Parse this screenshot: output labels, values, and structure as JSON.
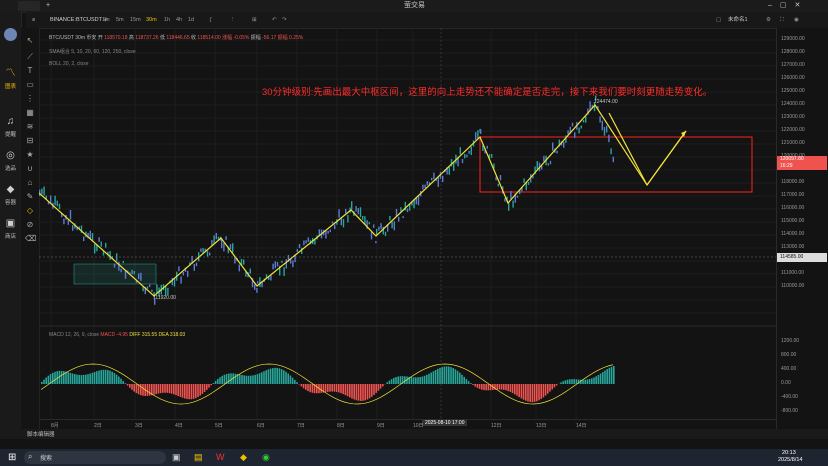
{
  "window": {
    "title": "萤交易",
    "tab_label": "+"
  },
  "toolbar": {
    "symbol": "BINANCE:BTCUSDT",
    "intervals": [
      "1m",
      "5m",
      "15m",
      "30m",
      "1h",
      "4h",
      "1d"
    ],
    "selected_interval": "30m",
    "right_label": "未命名1"
  },
  "nav": [
    {
      "icon": "chart-icon",
      "label": "图表"
    },
    {
      "icon": "bell-icon",
      "label": "提醒"
    },
    {
      "icon": "search-icon",
      "label": "选品"
    },
    {
      "icon": "diamond-icon",
      "label": "容器"
    },
    {
      "icon": "store-icon",
      "label": "商店"
    }
  ],
  "legend": {
    "title": "BTC/USDT 30m 币安",
    "open_label": "开",
    "open": "118570.18",
    "high_label": "高",
    "high": "118737.26",
    "low_label": "低",
    "low": "118446.65",
    "close_label": "收",
    "close": "118514.00",
    "change": "涨幅 -0.05%",
    "range_label": "振幅",
    "range_a": "-56.17",
    "range_b": "振幅 0.25%",
    "ma": "SMA组合 5, 10, 20, 60, 120, 250, close",
    "boll": "BOLL 20, 2, close"
  },
  "annotation": {
    "text": "30分钟级别:先画出最大中枢区间，这里的向上走势还不能确定是否走完，接下来我们要时刻更随走势变化。"
  },
  "price_labels": {
    "high": "124474.00",
    "low": "111920.00"
  },
  "current_price": {
    "value": "120097.80",
    "time": "16:29"
  },
  "ref_price": "114585.00",
  "price_axis": [
    "129000.00",
    "128000.00",
    "127000.00",
    "126000.00",
    "125000.00",
    "124000.00",
    "123000.00",
    "122000.00",
    "121000.00",
    "120000.00",
    "119000.00",
    "118000.00",
    "117000.00",
    "116000.00",
    "115000.00",
    "114000.00",
    "113000.00",
    "112000.00",
    "111000.00",
    "110000.00"
  ],
  "macd_axis": [
    "1200.00",
    "800.00",
    "400.00",
    "0.00",
    "-400.00",
    "-800.00"
  ],
  "macd_legend": {
    "name": "MACD 12, 26, 9, close",
    "macd": "MACD -4.95",
    "diff": "DIFF 315.55",
    "dea": "DEA 318.03"
  },
  "time_axis": [
    "8月",
    "2日",
    "3日",
    "4日",
    "5日",
    "6日",
    "7日",
    "8日",
    "9日",
    "10日",
    "12日",
    "13日",
    "14日"
  ],
  "crosshair_time": "2025-08-10 17:00",
  "bottom_bar": {
    "label": "脚本编辑器"
  },
  "taskbar": {
    "search": "搜索",
    "clock": "20:13",
    "date": "2025/8/14"
  },
  "colors": {
    "up": "#26a69a",
    "down": "#ef5350",
    "zigzag": "#f2e23a",
    "box": "#ff2222",
    "annotation": "#ff2b2b",
    "accent": "#f0c000"
  }
}
